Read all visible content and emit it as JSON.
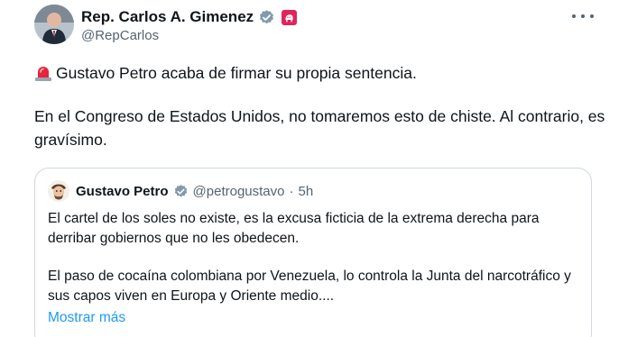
{
  "author": {
    "name": "Rep. Carlos A. Gimenez",
    "handle": "@RepCarlos",
    "verified_icon": "verified-badge-icon",
    "affiliation_icon": "republican-party-icon"
  },
  "menu_icon": "more-options-icon",
  "tweet": {
    "line1": "Gustavo Petro acaba de firmar su propia sentencia.",
    "line1_icon": "rotating-light-emoji",
    "paragraph2": "En el Congreso de Estados Unidos, no tomaremos esto de chiste. Al contrario, es gravísimo."
  },
  "quoted": {
    "name": "Gustavo Petro",
    "handle": "@petrogustavo",
    "separator": "·",
    "time": "5h",
    "verified_icon": "verified-badge-icon",
    "paragraph1": "El cartel de los soles no existe, es la excusa ficticia de la extrema derecha para derribar gobiernos que no les obedecen.",
    "paragraph2": "El paso de cocaína colombiana por Venezuela, lo controla la Junta del narcotráfico y sus capos viven en Europa y Oriente medio....",
    "show_more": "Mostrar más"
  },
  "colors": {
    "text": "#0f1419",
    "secondary": "#536471",
    "link": "#1d9bf0",
    "border": "#cfd9de",
    "verified_gray": "#829aab",
    "party_red": "#e0245e"
  }
}
